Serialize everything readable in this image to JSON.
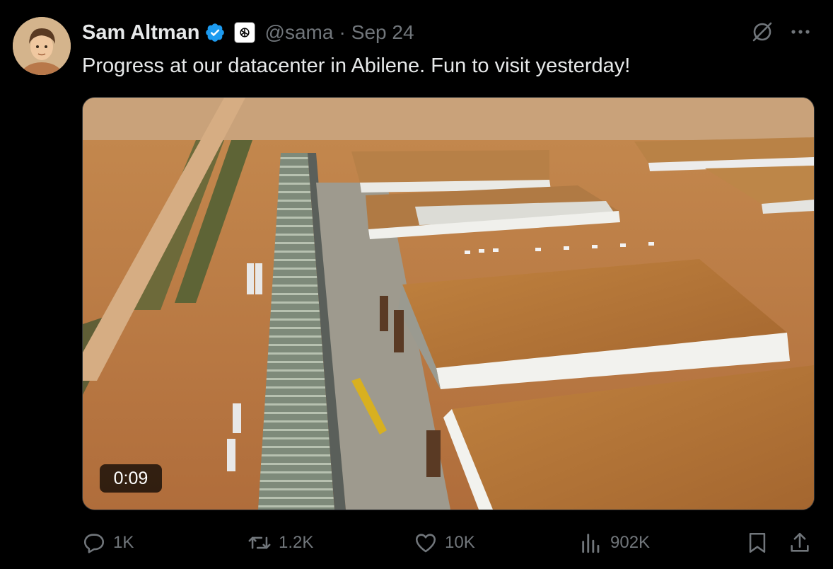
{
  "author": {
    "name": "Sam Altman",
    "handle": "@sama",
    "separator": "·",
    "date": "Sep 24"
  },
  "tweet": {
    "text": "Progress at our datacenter in Abilene. Fun to visit yesterday!"
  },
  "media": {
    "type": "video",
    "duration": "0:09"
  },
  "actions": {
    "replies": "1K",
    "reposts": "1.2K",
    "likes": "10K",
    "views": "902K"
  },
  "icons": {
    "verified": "verified-badge-icon",
    "org": "openai-logo-icon",
    "grok": "grok-icon",
    "more": "more-icon",
    "reply": "reply-icon",
    "repost": "repost-icon",
    "like": "heart-icon",
    "views": "views-icon",
    "bookmark": "bookmark-icon",
    "share": "share-icon"
  },
  "colors": {
    "background": "#000000",
    "text": "#e7e9ea",
    "muted": "#71767b",
    "verified": "#1d9bf0"
  }
}
